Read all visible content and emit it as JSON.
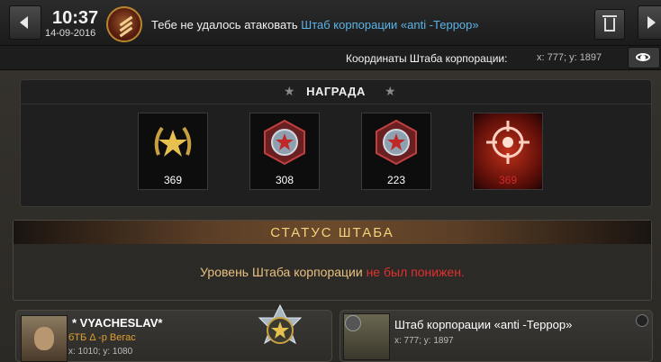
{
  "header": {
    "time": "10:37",
    "date": "14-09-2016",
    "subject_prefix": "Тебе не удалось атаковать ",
    "subject_link": "Штаб корпорации «anti -Террор»"
  },
  "coordinates": {
    "label": "Координаты Штаба корпорации:",
    "value": "x: 777; y: 1897"
  },
  "reward": {
    "title": "НАГРАДА",
    "items": [
      {
        "icon": "gold-laurel-star-medal-icon",
        "count": "369"
      },
      {
        "icon": "red-star-badge-icon",
        "count": "308"
      },
      {
        "icon": "red-star-badge-icon",
        "count": "223"
      },
      {
        "icon": "red-target-crosshair-icon",
        "count": "369"
      }
    ]
  },
  "status": {
    "title": "СТАТУС ШТАБА",
    "text_prefix": "Уровень Штаба корпорации ",
    "text_highlight": "не был понижен."
  },
  "player": {
    "name": "* VYACHESLAV*",
    "corp": "бТБ Δ -р Вегас",
    "coords": "x: 1010; y: 1080"
  },
  "target": {
    "name": "Штаб корпорации «anti -Террор»",
    "coords": "x: 777; y: 1897"
  },
  "colors": {
    "accent_gold": "#f3d27a",
    "link_blue": "#5ab4e8",
    "alert_red": "#e03030"
  }
}
